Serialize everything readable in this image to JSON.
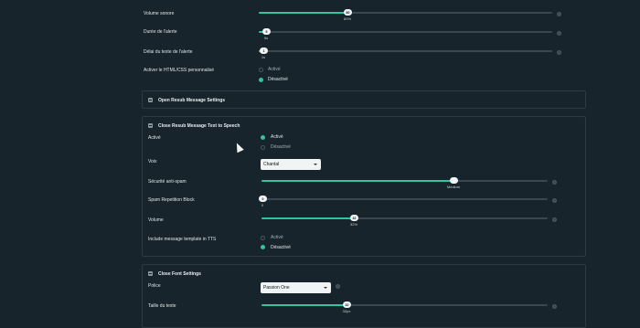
{
  "top": {
    "volume_label": "Volume sonore",
    "volume_value": "80%",
    "volume_knob": "80",
    "volume_fraction": 0.3,
    "duration_label": "Durée de l'alerte",
    "duration_value": "5s",
    "duration_knob": "5",
    "duration_fraction": 0.03,
    "text_delay_label": "Délai du texte de l'alerte",
    "text_delay_value": "1s",
    "text_delay_knob": "1",
    "text_delay_fraction": 0.02,
    "custom_html_label": "Activer le HTML/CSS personnalisé",
    "option_on": "Activé",
    "option_off": "Désactivé"
  },
  "open_resub": {
    "title": "Open Resub Message Settings"
  },
  "tts": {
    "title": "Close Resub Message Text to Speech",
    "active_label": "Activé",
    "active_on": "Activé",
    "active_off": "Désactivé",
    "voice_label": "Voix",
    "voice_value": "Chantal",
    "antispam_label": "Sécurité anti-spam",
    "antispam_value": "Medium",
    "antispam_fraction": 0.67,
    "spam_block_label": "Spam Repetition Block",
    "spam_block_value": "0",
    "spam_block_knob": "0",
    "spam_block_fraction": 0.0,
    "volume_label": "Volume",
    "volume_value": "32%",
    "volume_knob": "32",
    "volume_fraction": 0.32,
    "template_label": "Include message template in TTS",
    "template_on": "Activé",
    "template_off": "Désactivé"
  },
  "font": {
    "title": "Close Font Settings",
    "police_label": "Police",
    "police_value": "Passion One",
    "size_label": "Taille du texte",
    "size_value": "32px",
    "size_knob": "32",
    "size_fraction": 0.3
  },
  "colors": {
    "accent": "#31c3a2",
    "background": "#17242b"
  }
}
